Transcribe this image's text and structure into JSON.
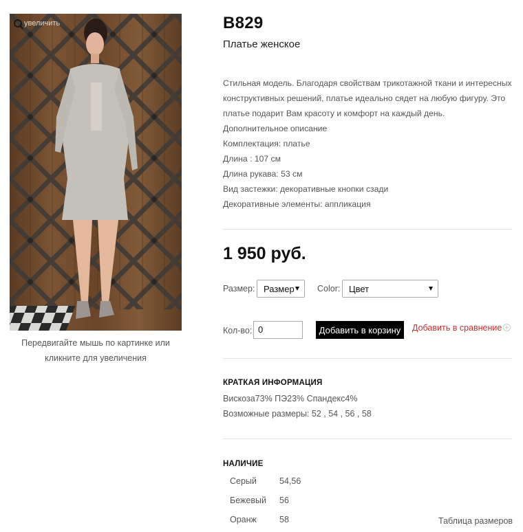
{
  "product": {
    "sku": "B829",
    "name": "Платье женское",
    "zoom_label": "увеличить",
    "image_hint": "Передвигайте мышь по картинке или кликните для увеличения",
    "description": [
      "Стильная модель. Благодаря свойствам трикотажной ткани и интересных конструктивных решений, платье идеально сядет на любую фигуру. Это платье подарит Вам красоту и комфорт на каждый день.",
      "Дополнительное описание",
      "Комплектация: платье",
      "Длина : 107 см",
      "Длина рукава: 53 см",
      "Вид застежки: декоративные кнопки сзади",
      "Декоративные элементы: аппликация"
    ],
    "price": "1 950 руб."
  },
  "options": {
    "size_label": "Размер:",
    "size_value": "Размер",
    "color_label": "Color:",
    "color_value": "Цвет"
  },
  "cart": {
    "qty_label": "Кол-во:",
    "qty_value": "0",
    "add_button": "Добавить в корзину",
    "compare_link": "Добавить в сравнение"
  },
  "short_info": {
    "heading": "КРАТКАЯ ИНФОРМАЦИЯ",
    "composition": "Вискоза73% ПЭ23% Спандекс4%",
    "sizes": "Возможные размеры: 52 , 54 , 56 , 58"
  },
  "availability": {
    "heading": "НАЛИЧИЕ",
    "rows": [
      {
        "color": "Серый",
        "sizes": "54,56"
      },
      {
        "color": "Бежевый",
        "sizes": "56"
      },
      {
        "color": "Оранж",
        "sizes": "58"
      }
    ]
  },
  "size_table_link": "Таблица размеров",
  "colors": {
    "accent_link": "#c9302c",
    "button_bg": "#000000",
    "text": "#555555",
    "heading": "#111111"
  }
}
